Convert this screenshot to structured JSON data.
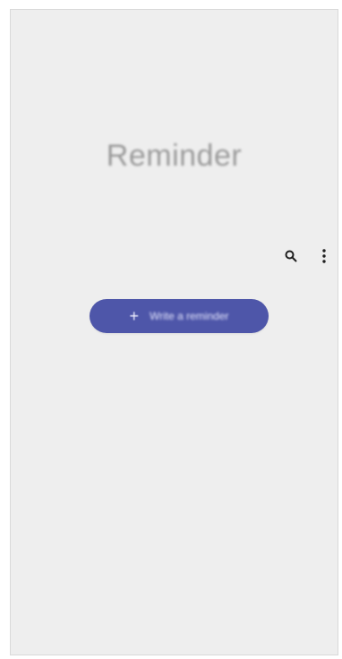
{
  "app": {
    "title": "Reminder"
  },
  "toolbar": {
    "search_icon": "search-icon",
    "more_icon": "more-vertical-icon"
  },
  "add_button": {
    "plus": "+",
    "label": "Write a reminder"
  },
  "colors": {
    "screen_bg": "#eeeeee",
    "accent": "#4e56a9"
  }
}
